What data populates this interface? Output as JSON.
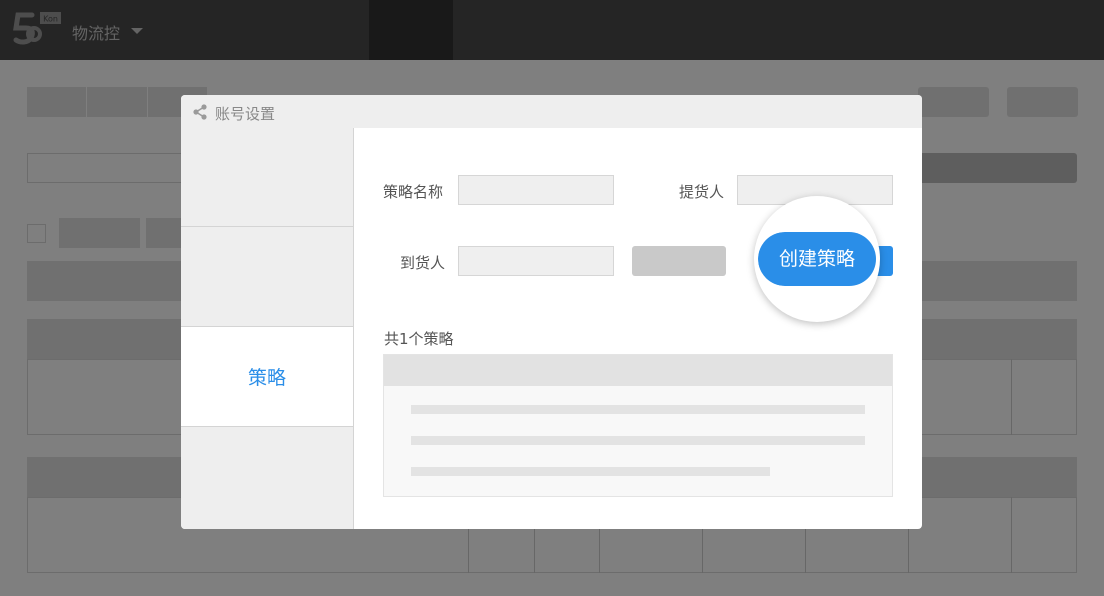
{
  "app": {
    "name": "物流控",
    "logo_badge": "Kon"
  },
  "modal": {
    "title": "账号设置",
    "nav": [
      {
        "label": ""
      },
      {
        "label": ""
      },
      {
        "label": "策略",
        "active": true
      },
      {
        "label": ""
      }
    ],
    "form": {
      "strategy_name_label": "策略名称",
      "strategy_name_value": "",
      "pickup_label": "提货人",
      "pickup_value": "",
      "receiver_label": "到货人",
      "receiver_value": "",
      "query_label": "",
      "create_label": "创建策略"
    },
    "list": {
      "count_text": "共1个策略",
      "rows": 1
    }
  },
  "colors": {
    "accent": "#2a8ee8",
    "topbar": "#4a4a4a",
    "overlay": "rgba(0,0,0,0.5)"
  }
}
